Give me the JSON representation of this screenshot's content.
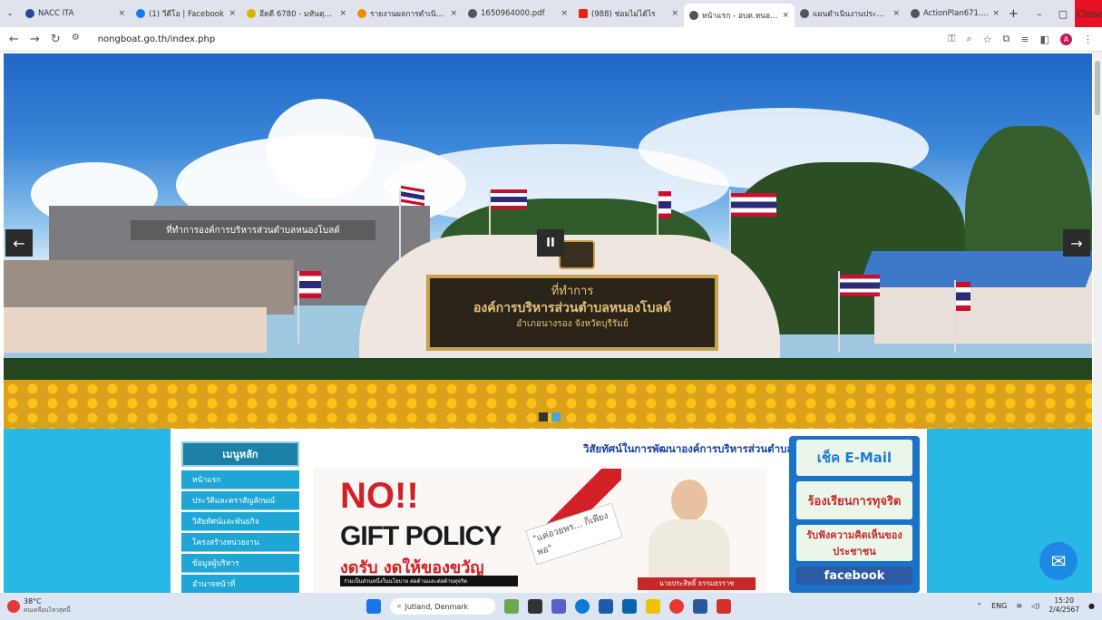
{
  "browser": {
    "tabs": [
      {
        "label": "NACC ITA",
        "icon": "itá-icon"
      },
      {
        "label": "(1) วีดีโอ | Facebook",
        "icon": "facebook-icon"
      },
      {
        "label": "อีดดี 6780 - มหันตุมุลท",
        "icon": "mail-icon"
      },
      {
        "label": "รายงานผลการดำเนินการ",
        "icon": "doc-icon"
      },
      {
        "label": "1650964000.pdf",
        "icon": "globe-icon"
      },
      {
        "label": "(988) ช่อมไม่ได้ไร",
        "icon": "youtube-icon"
      },
      {
        "label": "หน้าแรก - อบต.หนองโบ",
        "icon": "globe-icon"
      },
      {
        "label": "แผนดำเนินงานประจำปี",
        "icon": "globe-icon"
      },
      {
        "label": "ActionPlan671.pdf",
        "icon": "globe-icon"
      }
    ],
    "active_tab_index": 6,
    "close_tooltip": "Close",
    "url": "nongboat.go.th/index.php"
  },
  "hero": {
    "sign_line1": "ที่ทำการ",
    "sign_line2": "องค์การบริหารส่วนตำบลหนองโบลด์",
    "sign_line3": "อำเภอนางรอง  จังหวัดบุรีรัมย์",
    "building_sign": "ที่ทำการองค์การบริหารส่วนตำบลหนองโบลด์",
    "prev_label": "←",
    "next_label": "→",
    "pause_label": "II"
  },
  "menu": {
    "title": "เมนูหลัก",
    "items": [
      "หน้าแรก",
      "ประวัติและตราสัญลักษณ์",
      "วิสัยทัศน์และพันธกิจ",
      "โครงสร้างหน่วยงาน",
      "ข้อมูลผู้บริหาร",
      "อำนาจหน้าที่"
    ]
  },
  "main": {
    "marquee": "วิสัยทัศน์ในการพัฒนาองค์การบริหารส่วนตำบล",
    "banner_no": "NO!!",
    "banner_policy": "GIFT POLICY",
    "banner_thai": "งดรับ งดให้ของขวัญ",
    "banner_bar": "ร่วมเป็นส่วนหนึ่งในนโยบาย ต่อต้านและต่อต้านทุจริต",
    "banner_tag": "\"แค่อวยพร... ก็เพียงพอ\"",
    "person_name": "นายประสิทธิ์  ธรรมธรราช"
  },
  "sidebar": {
    "email": "เช็ค E-Mail",
    "complaint": "ร้องเรียนการทุจริต",
    "opinion": "รับฟังความคิดเห็นของประชาชน",
    "facebook": "facebook"
  },
  "taskbar": {
    "temp": "38°C",
    "weather_note": "คนเคลื่อนไหวสุดนี้",
    "search": "Jutland, Denmark",
    "lang": "ENG",
    "time": "15:20",
    "date": "2/4/2567"
  }
}
